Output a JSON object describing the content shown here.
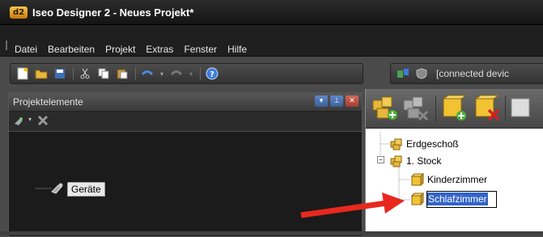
{
  "window": {
    "title": "Iseo Designer 2 - Neues Projekt*",
    "logo_text": "d2"
  },
  "menu": {
    "items": [
      {
        "label": "Datei"
      },
      {
        "label": "Bearbeiten"
      },
      {
        "label": "Projekt"
      },
      {
        "label": "Extras"
      },
      {
        "label": "Fenster"
      },
      {
        "label": "Hilfe"
      }
    ]
  },
  "right_toolbar": {
    "status": "[connected devic"
  },
  "left_panel": {
    "title": "Projektelemente",
    "tree": {
      "root_label": "Geräte"
    }
  },
  "right_panel": {
    "tree": {
      "floors": [
        {
          "label": "Erdgeschoß"
        },
        {
          "label": "1. Stock",
          "expander": "−"
        }
      ],
      "rooms": [
        {
          "label": "Kinderzimmer"
        },
        {
          "label": "Schlafzimmer",
          "editing": true
        }
      ]
    }
  },
  "colors": {
    "arrow": "#e8281e",
    "selection": "#3264c8",
    "window_bg": "#4a4a4a"
  }
}
